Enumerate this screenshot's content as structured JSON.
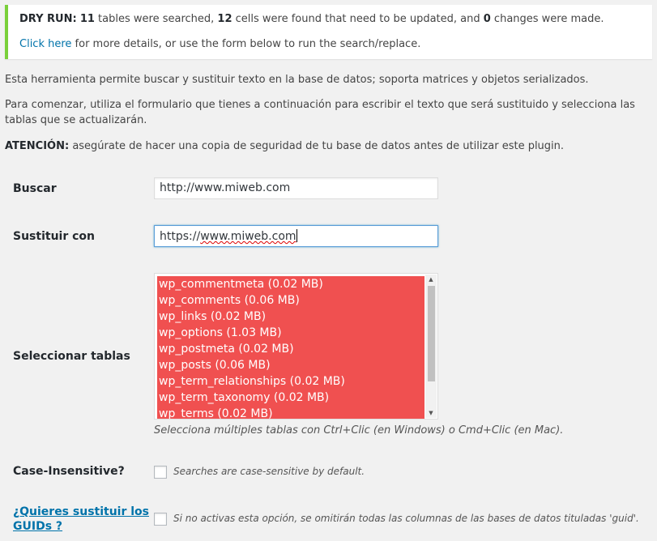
{
  "notice": {
    "dry_run_label": "DRY RUN:",
    "tables_count": "11",
    "tables_text": " tables were searched, ",
    "cells_count": "12",
    "cells_text": " cells were found that need to be updated, and ",
    "changes_count": "0",
    "changes_text": " changes were made.",
    "link_text": "Click here",
    "details_text": " for more details, or use the form below to run the search/replace.",
    "accent_color": "#7ad03a"
  },
  "intro": {
    "line1": "Esta herramienta permite buscar y sustituir texto en la base de datos; soporta matrices y objetos serializados.",
    "line2": "Para comenzar, utiliza el formulario que tienes a continuación para escribir el texto que será sustituido y selecciona las tablas que se actualizarán.",
    "warning_label": "ATENCIÓN:",
    "warning_text": " asegúrate de hacer una copia de seguridad de tu base de datos antes de utilizar este plugin."
  },
  "form": {
    "search": {
      "label": "Buscar",
      "value": "http://www.miweb.com"
    },
    "replace": {
      "label": "Sustituir con",
      "value_prefix": "https://",
      "value_misspelled": "www.miweb.com"
    },
    "tables": {
      "label": "Seleccionar tablas",
      "options": [
        "wp_commentmeta (0.02 MB)",
        "wp_comments (0.06 MB)",
        "wp_links (0.02 MB)",
        "wp_options (1.03 MB)",
        "wp_postmeta (0.02 MB)",
        "wp_posts (0.06 MB)",
        "wp_term_relationships (0.02 MB)",
        "wp_term_taxonomy (0.02 MB)",
        "wp_terms (0.02 MB)"
      ],
      "selected_color": "#f05050",
      "hint": "Selecciona múltiples tablas con Ctrl+Clic (en Windows) o Cmd+Clic (en Mac)."
    },
    "case_insensitive": {
      "label": "Case-Insensitive?",
      "hint": "Searches are case-sensitive by default."
    },
    "guids": {
      "label_line1": "¿Quieres sustituir los",
      "label_line2": "GUIDs ?",
      "hint": "Si no activas esta opción, se omitirán todas las columnas de las bases de datos tituladas 'guid'."
    }
  }
}
